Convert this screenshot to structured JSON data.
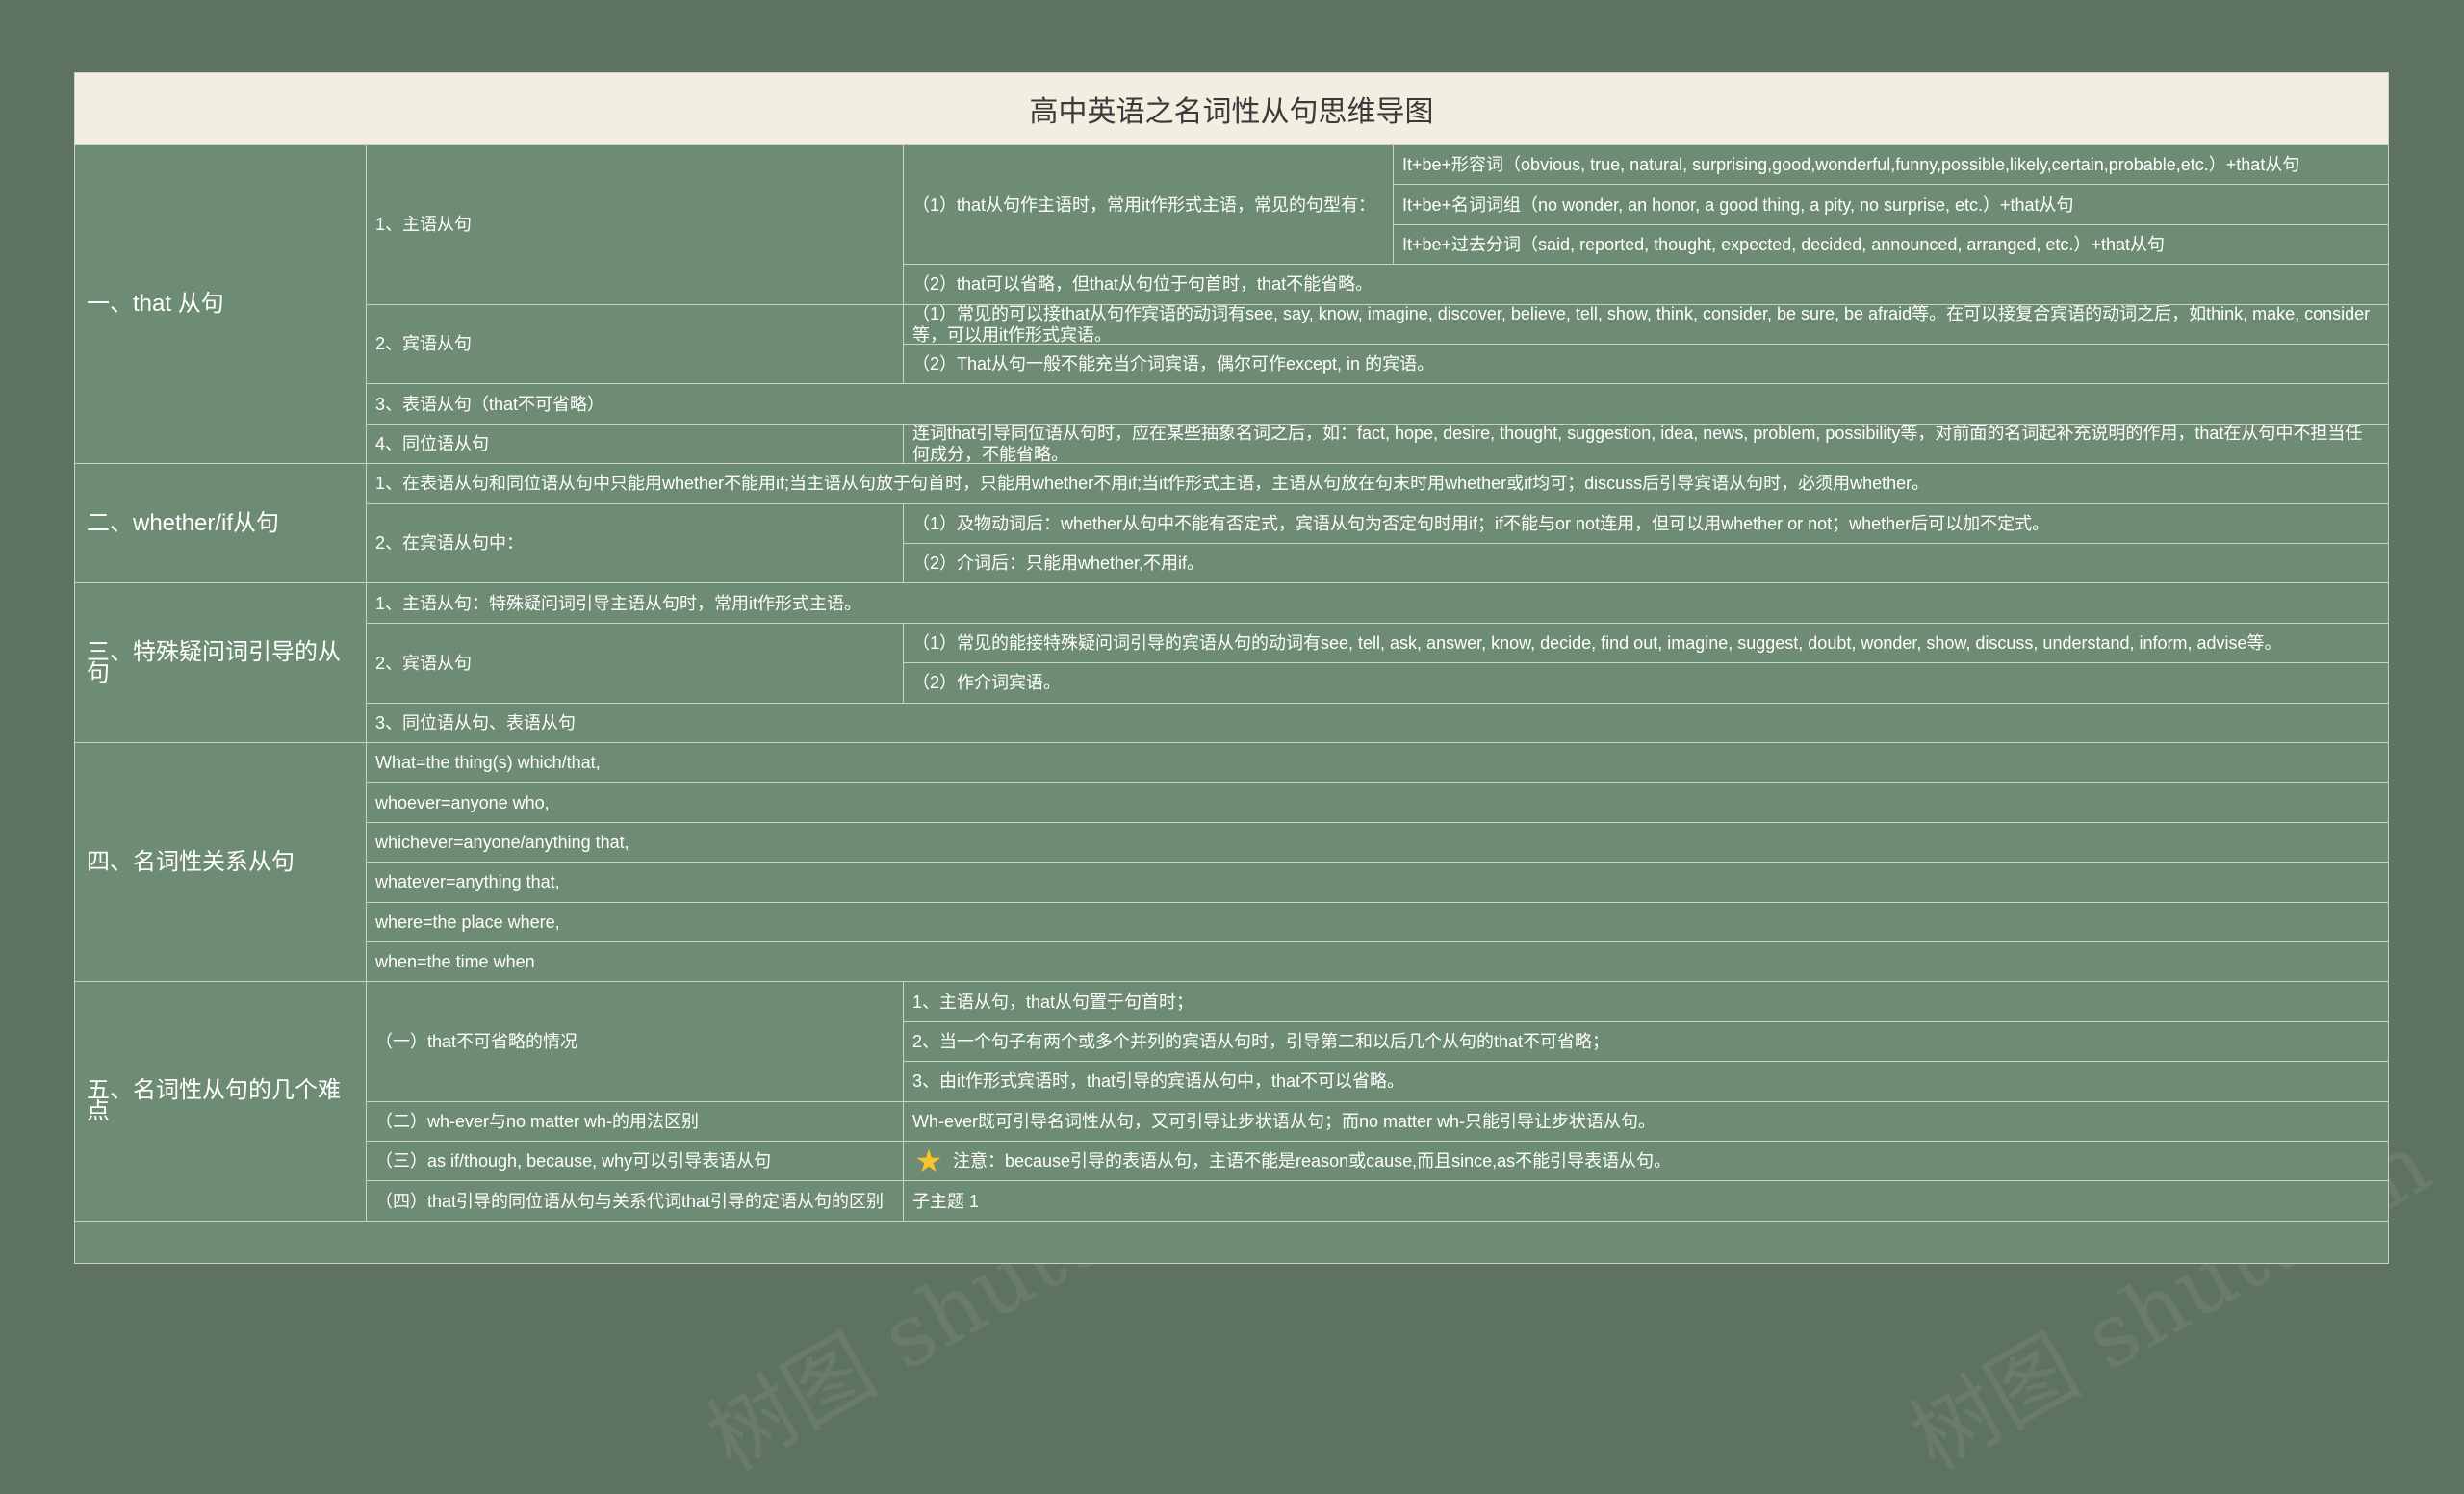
{
  "title": "高中英语之名词性从句思维导图",
  "watermark": "树图 shutu.cn",
  "sections": [
    {
      "label": "一、that 从句",
      "items": [
        {
          "label": "1、主语从句",
          "sub": [
            {
              "label": "（1）that从句作主语时，常用it作形式主语，常见的句型有：",
              "leaves": [
                "It+be+形容词（obvious, true, natural, surprising,good,wonderful,funny,possible,likely,certain,probable,etc.）+that从句",
                "It+be+名词词组（no wonder, an honor, a good thing, a pity, no surprise, etc.）+that从句",
                "It+be+过去分词（said, reported, thought, expected, decided, announced, arranged, etc.）+that从句"
              ]
            },
            {
              "label": "（2）that可以省略，但that从句位于句首时，that不能省略。"
            }
          ]
        },
        {
          "label": "2、宾语从句",
          "sub": [
            {
              "label": "（1）常见的可以接that从句作宾语的动词有see, say, know, imagine, discover, believe, tell, show, think, consider, be sure, be afraid等。在可以接复合宾语的动词之后，如think, make, consider等，可以用it作形式宾语。"
            },
            {
              "label": "（2）That从句一般不能充当介词宾语，偶尔可作except, in 的宾语。"
            }
          ]
        },
        {
          "label": "3、表语从句（that不可省略）"
        },
        {
          "label": "4、同位语从句",
          "sub": [
            {
              "label": "连词that引导同位语从句时，应在某些抽象名词之后，如：fact, hope, desire, thought, suggestion, idea, news, problem, possibility等，对前面的名词起补充说明的作用，that在从句中不担当任何成分，不能省略。"
            }
          ]
        }
      ]
    },
    {
      "label": "二、whether/if从句",
      "items": [
        {
          "label": "1、在表语从句和同位语从句中只能用whether不能用if;当主语从句放于句首时，只能用whether不用if;当it作形式主语，主语从句放在句末时用whether或if均可；discuss后引导宾语从句时，必须用whether。"
        },
        {
          "label": "2、在宾语从句中：",
          "sub": [
            {
              "label": "（1）及物动词后：whether从句中不能有否定式，宾语从句为否定句时用if；if不能与or not连用，但可以用whether or not；whether后可以加不定式。"
            },
            {
              "label": "（2）介词后：只能用whether,不用if。"
            }
          ]
        }
      ]
    },
    {
      "label": "三、特殊疑问词引导的从句",
      "items": [
        {
          "label": "1、主语从句：特殊疑问词引导主语从句时，常用it作形式主语。"
        },
        {
          "label": "2、宾语从句",
          "sub": [
            {
              "label": "（1）常见的能接特殊疑问词引导的宾语从句的动词有see, tell, ask, answer, know, decide, find out, imagine, suggest, doubt, wonder, show, discuss, understand, inform, advise等。"
            },
            {
              "label": "（2）作介词宾语。"
            }
          ]
        },
        {
          "label": "3、同位语从句、表语从句"
        }
      ]
    },
    {
      "label": "四、名词性关系从句",
      "items": [
        {
          "label": "What=the thing(s) which/that,"
        },
        {
          "label": "whoever=anyone who,"
        },
        {
          "label": " whichever=anyone/anything that,"
        },
        {
          "label": " whatever=anything that,"
        },
        {
          "label": "where=the place where,"
        },
        {
          "label": "when=the time when"
        }
      ]
    },
    {
      "label": "五、名词性从句的几个难点",
      "items": [
        {
          "label": "（一）that不可省略的情况",
          "sub": [
            {
              "label": "1、主语从句，that从句置于句首时；"
            },
            {
              "label": "2、当一个句子有两个或多个并列的宾语从句时，引导第二和以后几个从句的that不可省略；"
            },
            {
              "label": "3、由it作形式宾语时，that引导的宾语从句中，that不可以省略。"
            }
          ]
        },
        {
          "label": "（二）wh-ever与no matter wh-的用法区别",
          "sub": [
            {
              "label": "Wh-ever既可引导名词性从句，又可引导让步状语从句；而no matter wh-只能引导让步状语从句。"
            }
          ]
        },
        {
          "label": "（三）as if/though, because, why可以引导表语从句",
          "sub": [
            {
              "label": "注意：because引导的表语从句，主语不能是reason或cause,而且since,as不能引导表语从句。",
              "icon": "star-icon"
            }
          ]
        },
        {
          "label": "（四）that引导的同位语从句与关系代词that引导的定语从句的区别",
          "sub": [
            {
              "label": "子主题 1"
            }
          ]
        }
      ]
    }
  ],
  "colors": {
    "background": "#5e7262",
    "cell": "#6e8c73",
    "title_bg": "#f2efe0",
    "border": "#c9d2c4",
    "star": "#f6c431"
  }
}
